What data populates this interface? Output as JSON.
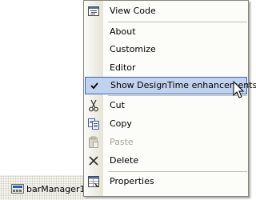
{
  "tray": {
    "item_label": "barManager1",
    "icon": "bar-manager-icon"
  },
  "menu": {
    "items": [
      {
        "label": "View Code",
        "icon": "view-code-icon"
      },
      {
        "label": "About"
      },
      {
        "label": "Customize"
      },
      {
        "label": "Editor"
      },
      {
        "label": "Show DesignTime enhancements",
        "icon": "checkmark-icon",
        "checked": true,
        "highlighted": true
      },
      {
        "label": "Cut",
        "icon": "scissors-icon"
      },
      {
        "label": "Copy",
        "icon": "copy-icon"
      },
      {
        "label": "Paste",
        "icon": "paste-icon",
        "disabled": true
      },
      {
        "label": "Delete",
        "icon": "delete-icon"
      },
      {
        "label": "Properties",
        "icon": "properties-icon"
      }
    ],
    "highlight_color": "#c1d2ee",
    "highlight_border": "#316ac5"
  }
}
